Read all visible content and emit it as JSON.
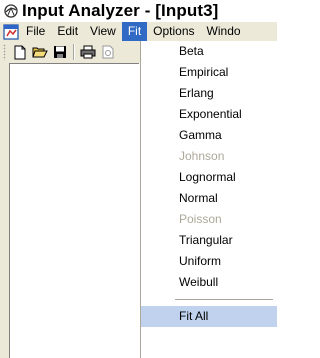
{
  "window": {
    "title": "Input Analyzer - [Input3]"
  },
  "menubar": {
    "items": [
      {
        "label": "File"
      },
      {
        "label": "Edit"
      },
      {
        "label": "View"
      },
      {
        "label": "Fit"
      },
      {
        "label": "Options"
      },
      {
        "label": "Windo"
      }
    ],
    "active": "Fit"
  },
  "toolbar": {
    "buttons": [
      "new-document-icon",
      "open-folder-icon",
      "save-disk-icon",
      "print-icon",
      "print-preview-icon"
    ]
  },
  "fit_menu": {
    "items": [
      {
        "label": "Beta",
        "enabled": true
      },
      {
        "label": "Empirical",
        "enabled": true
      },
      {
        "label": "Erlang",
        "enabled": true
      },
      {
        "label": "Exponential",
        "enabled": true
      },
      {
        "label": "Gamma",
        "enabled": true
      },
      {
        "label": "Johnson",
        "enabled": false
      },
      {
        "label": "Lognormal",
        "enabled": true
      },
      {
        "label": "Normal",
        "enabled": true
      },
      {
        "label": "Poisson",
        "enabled": false
      },
      {
        "label": "Triangular",
        "enabled": true
      },
      {
        "label": "Uniform",
        "enabled": true
      },
      {
        "label": "Weibull",
        "enabled": true
      }
    ],
    "fit_all": {
      "label": "Fit All",
      "highlighted": true
    }
  },
  "colors": {
    "menu_highlight": "#316ac5",
    "item_hover": "#c1d2ee",
    "disabled_text": "#aca899",
    "chrome": "#ece9d8"
  }
}
